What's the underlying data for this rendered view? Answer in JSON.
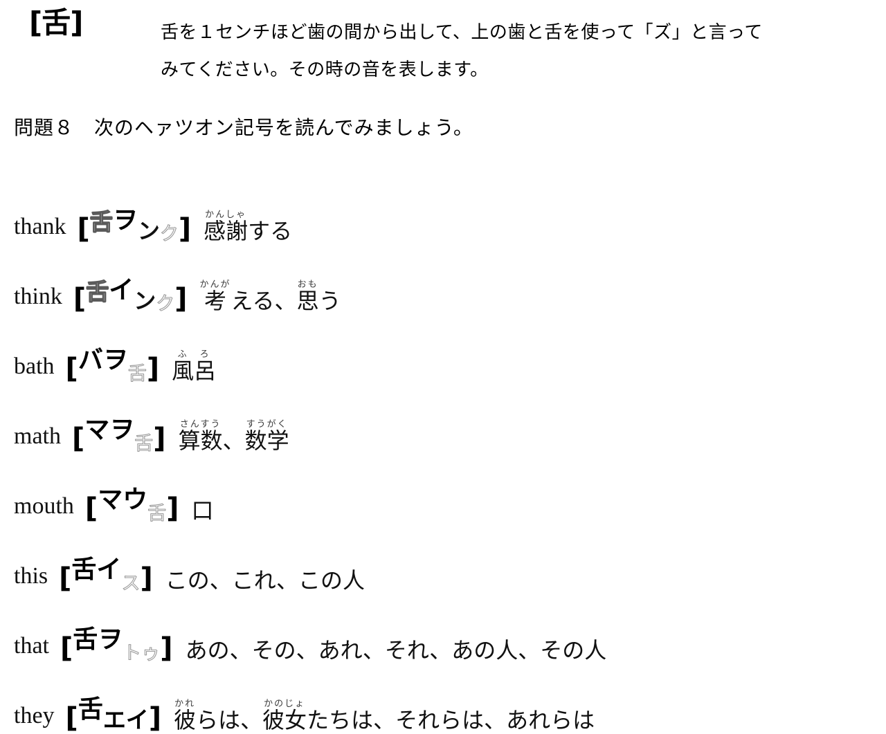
{
  "note": {
    "symbol": "[舌]",
    "lines": [
      "舌を１センチほど歯の間から出して、上の歯と舌を使って「ズ」と言って",
      "みてください。その時の音を表します。"
    ]
  },
  "question": {
    "heading": "問題８　次のヘァツオン記号を読んでみましょう。"
  },
  "brackets": {
    "open": "[",
    "close": "]"
  },
  "entries": [
    {
      "word": "thank",
      "phonetic_kana": [
        {
          "char": "舌",
          "style": "hollow"
        },
        {
          "char": "ヲ",
          "style": "solid"
        },
        {
          "char": "ン",
          "style": "half"
        },
        {
          "char": "ク",
          "style": "faint"
        }
      ],
      "meaning_parts": [
        {
          "text": "感謝",
          "furigana": "かんしゃ"
        },
        {
          "text": "する",
          "furigana": ""
        }
      ],
      "meaning_plain": "感謝する"
    },
    {
      "word": "think",
      "phonetic_kana": [
        {
          "char": "舌",
          "style": "hollow"
        },
        {
          "char": "イ",
          "style": "solid"
        },
        {
          "char": "ン",
          "style": "half"
        },
        {
          "char": "ク",
          "style": "faint"
        }
      ],
      "meaning_parts": [
        {
          "text": "考",
          "furigana": "かんが"
        },
        {
          "text": "える、",
          "furigana": ""
        },
        {
          "text": "思",
          "furigana": "おも"
        },
        {
          "text": "う",
          "furigana": ""
        }
      ],
      "meaning_plain": "考える、思う"
    },
    {
      "word": "bath",
      "phonetic_kana": [
        {
          "char": "バ",
          "style": "solid"
        },
        {
          "char": "ヲ",
          "style": "solid"
        },
        {
          "char": "舌",
          "style": "faint"
        }
      ],
      "meaning_parts": [
        {
          "text": "風",
          "furigana": "ふ"
        },
        {
          "text": "呂",
          "furigana": "ろ"
        }
      ],
      "meaning_plain": "風呂"
    },
    {
      "word": "math",
      "phonetic_kana": [
        {
          "char": "マ",
          "style": "solid"
        },
        {
          "char": "ヲ",
          "style": "solid"
        },
        {
          "char": "舌",
          "style": "faint"
        }
      ],
      "meaning_parts": [
        {
          "text": "算数",
          "furigana": "さんすう"
        },
        {
          "text": "、",
          "furigana": ""
        },
        {
          "text": "数学",
          "furigana": "すうがく"
        }
      ],
      "meaning_plain": "算数、数学"
    },
    {
      "word": "mouth",
      "phonetic_kana": [
        {
          "char": "マ",
          "style": "solid"
        },
        {
          "char": "ウ",
          "style": "solid"
        },
        {
          "char": "舌",
          "style": "faint"
        }
      ],
      "meaning_parts": [
        {
          "text": "口",
          "furigana": ""
        }
      ],
      "meaning_plain": "口"
    },
    {
      "word": "this",
      "phonetic_kana": [
        {
          "char": "舌",
          "style": "solid"
        },
        {
          "char": "イ",
          "style": "solid"
        },
        {
          "char": "ス",
          "style": "faint"
        }
      ],
      "meaning_parts": [
        {
          "text": "この、これ、この",
          "furigana": ""
        },
        {
          "text": "人",
          "furigana": ""
        }
      ],
      "meaning_plain": "この、これ、この人"
    },
    {
      "word": "that",
      "phonetic_kana": [
        {
          "char": "舌",
          "style": "solid"
        },
        {
          "char": "ヲ",
          "style": "solid"
        },
        {
          "char": "ト",
          "style": "faint"
        },
        {
          "char": "ゥ",
          "style": "faint"
        }
      ],
      "meaning_parts": [
        {
          "text": "あの、その、あれ、それ、あの人、その人",
          "furigana": ""
        }
      ],
      "meaning_plain": "あの、その、あれ、それ、あの人、その人"
    },
    {
      "word": "they",
      "phonetic_kana": [
        {
          "char": "舌",
          "style": "solid"
        },
        {
          "char": "エ",
          "style": "base"
        },
        {
          "char": "イ",
          "style": "base"
        }
      ],
      "meaning_parts": [
        {
          "text": "彼",
          "furigana": "かれ"
        },
        {
          "text": "らは、",
          "furigana": ""
        },
        {
          "text": "彼女",
          "furigana": "かのじょ"
        },
        {
          "text": "たちは、それらは、あれらは",
          "furigana": ""
        }
      ],
      "meaning_plain": "彼らは、彼女たちは、それらは、あれらは"
    }
  ]
}
